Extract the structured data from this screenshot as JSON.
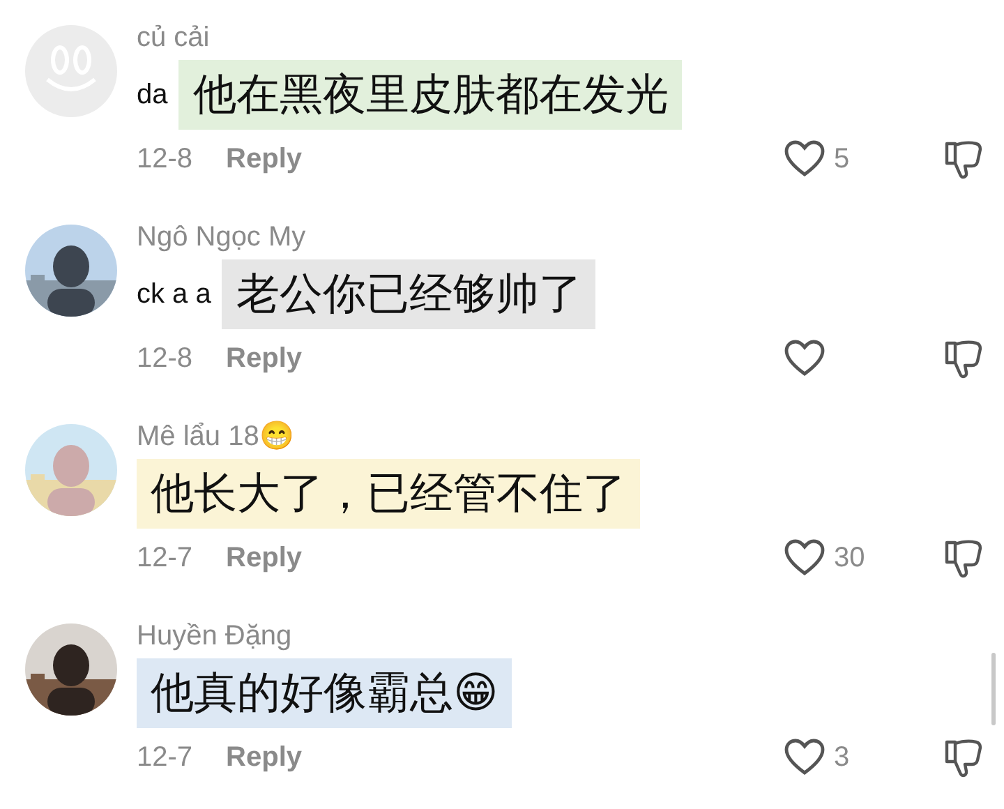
{
  "comments": [
    {
      "avatar": {
        "kind": "icon"
      },
      "username": "củ cải",
      "text": "da",
      "caption": "他在黑夜里皮肤都在发光",
      "color": "#e2f0dc",
      "date": "12-8",
      "reply": "Reply",
      "likes": "5"
    },
    {
      "username": "Ngô Ngọc My",
      "text": "ck a a",
      "caption": "老公你已经够帅了",
      "color": "#e6e6e6",
      "date": "12-8",
      "reply": "Reply"
    },
    {
      "username": "Mê lẩu 18😁",
      "caption": "他长大了，已经管不住了",
      "color": "#fbf4d6",
      "date": "12-7",
      "reply": "Reply",
      "likes": "30"
    },
    {
      "username": "Huyền Đặng",
      "caption": "他真的好像霸总😁",
      "color": "#dde8f4",
      "date": "12-7",
      "reply": "Reply",
      "likes": "3"
    }
  ]
}
